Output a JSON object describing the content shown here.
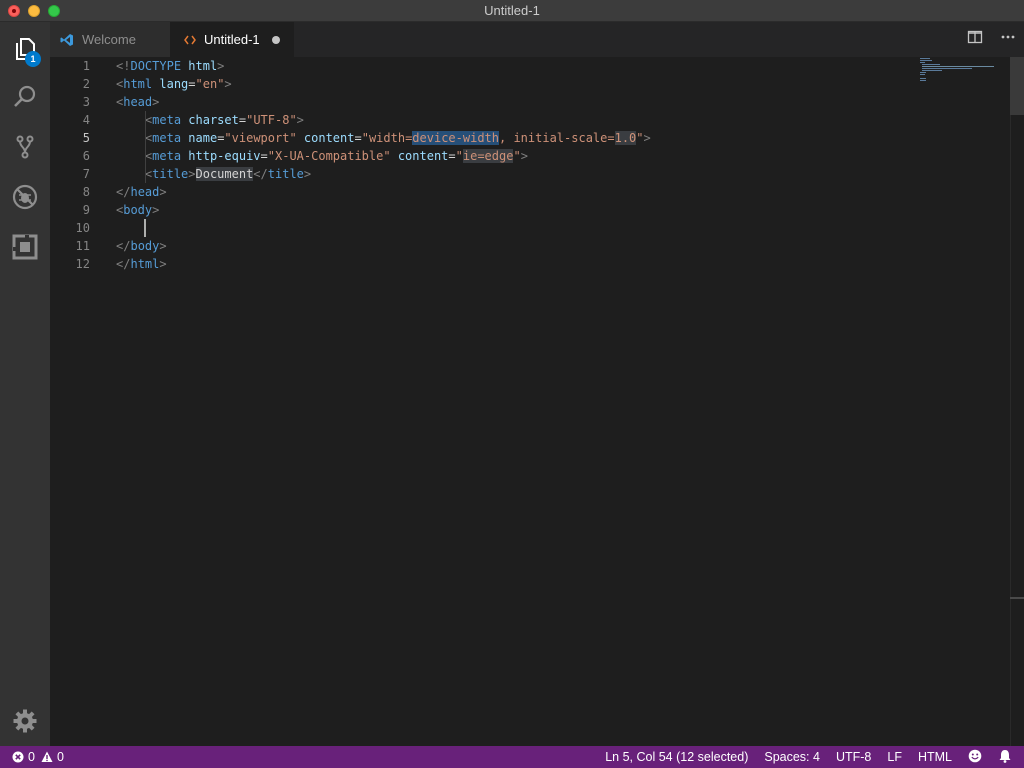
{
  "window": {
    "title": "Untitled-1"
  },
  "activity_bar": {
    "items": [
      {
        "name": "explorer",
        "icon": "files-icon",
        "badge": "1"
      },
      {
        "name": "search",
        "icon": "search-icon"
      },
      {
        "name": "source-control",
        "icon": "source-control-icon"
      },
      {
        "name": "debug",
        "icon": "debug-icon"
      },
      {
        "name": "extensions",
        "icon": "extensions-icon"
      }
    ],
    "settings_icon": "gear-icon"
  },
  "tabs": [
    {
      "label": "Welcome",
      "icon": "vscode-icon",
      "active": false
    },
    {
      "label": "Untitled-1",
      "icon": "html-file-icon",
      "active": true,
      "dirty": true
    }
  ],
  "tab_actions": [
    {
      "name": "split-editor",
      "icon": "split-editor-icon"
    },
    {
      "name": "more-actions",
      "icon": "ellipsis-icon"
    }
  ],
  "editor": {
    "current_line": 5,
    "line_numbers": [
      "1",
      "2",
      "3",
      "4",
      "5",
      "6",
      "7",
      "8",
      "9",
      "10",
      "11",
      "12"
    ],
    "lines": [
      "<!DOCTYPE html>",
      "<html lang=\"en\">",
      "<head>",
      "    <meta charset=\"UTF-8\">",
      "    <meta name=\"viewport\" content=\"width=device-width, initial-scale=1.0\">",
      "    <meta http-equiv=\"X-UA-Compatible\" content=\"ie=edge\">",
      "    <title>Document</title>",
      "</head>",
      "<body>",
      "    ",
      "</body>",
      "</html>"
    ]
  },
  "statusbar": {
    "errors": "0",
    "warnings": "0",
    "position": "Ln 5, Col 54 (12 selected)",
    "indentation": "Spaces: 4",
    "encoding": "UTF-8",
    "eol": "LF",
    "language": "HTML",
    "feedback_icon": "smiley-icon",
    "notifications_icon": "bell-icon",
    "color": "#68217a"
  },
  "colors": {
    "tag": "#569cd6",
    "attribute": "#9cdcfe",
    "string": "#ce9178",
    "punctuation": "#808080",
    "selection": "#264f78"
  }
}
